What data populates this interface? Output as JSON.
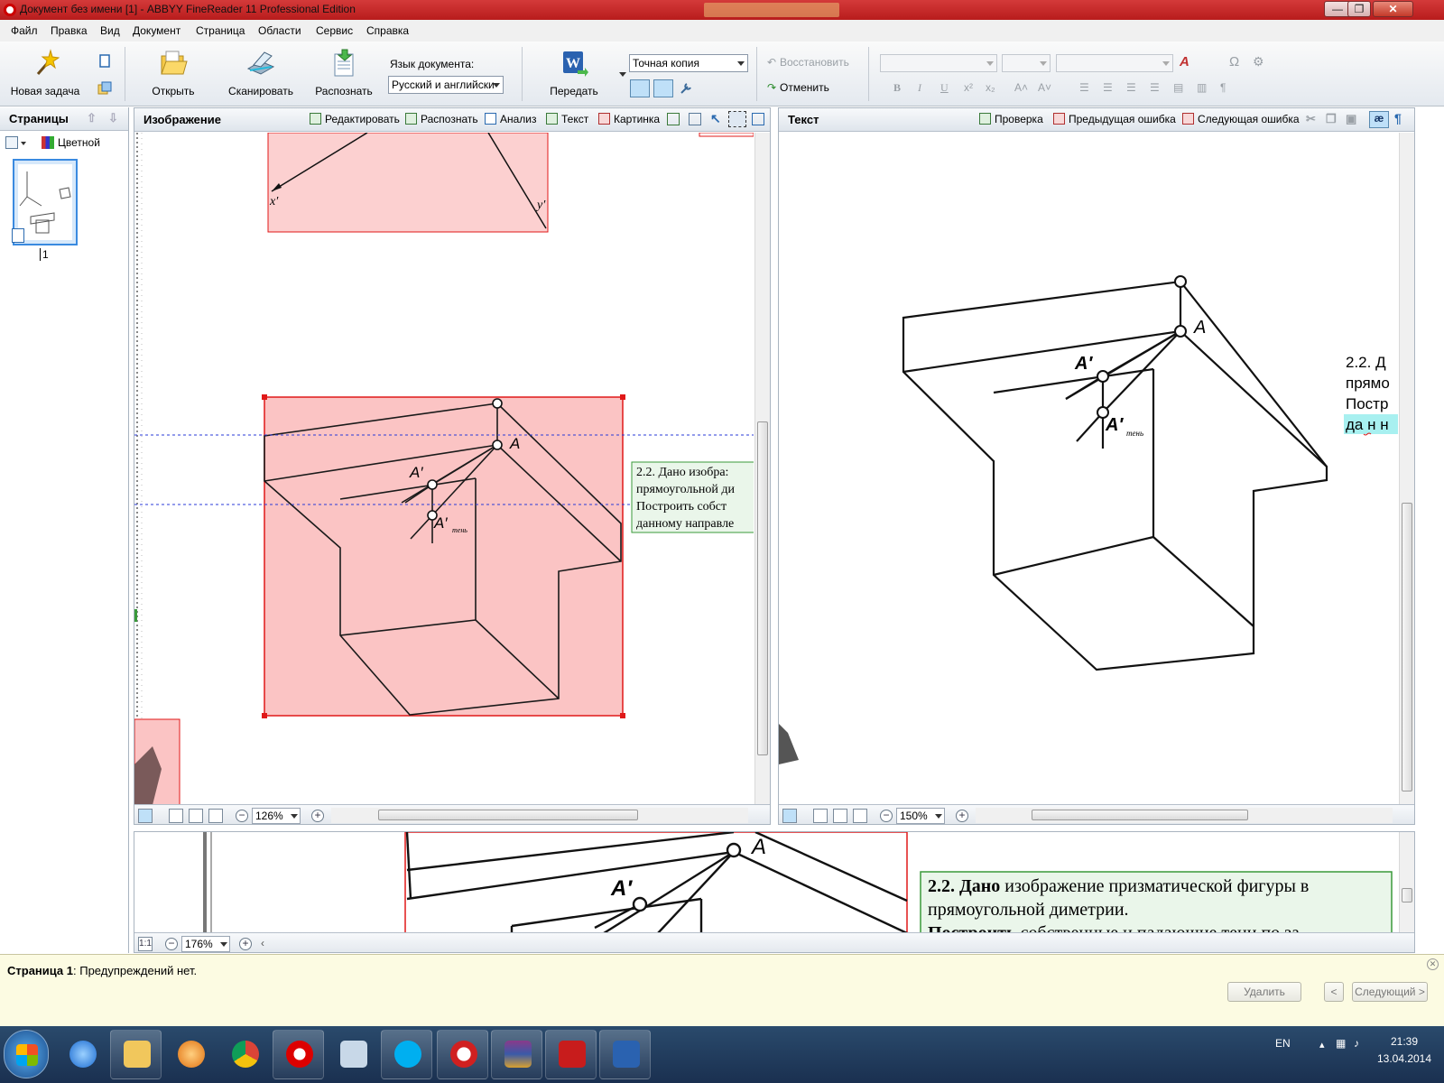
{
  "window": {
    "title": "Документ без имени [1] - ABBYY FineReader 11 Professional Edition",
    "minimize": "—",
    "maximize": "❐",
    "close": "✕"
  },
  "menu": [
    "Файл",
    "Правка",
    "Вид",
    "Документ",
    "Страница",
    "Области",
    "Сервис",
    "Справка"
  ],
  "toolbar": {
    "new_task": "Новая задача",
    "open": "Открыть",
    "scan": "Сканировать",
    "recognize": "Распознать",
    "doc_language_label": "Язык документа:",
    "doc_language_value": "Русский и английски",
    "send": "Передать",
    "format_value": "Точная копия",
    "undo": "Восстановить",
    "redo": "Отменить",
    "bold": "B",
    "italic": "I",
    "underline": "U",
    "omega": "Ω"
  },
  "pages_panel": {
    "title": "Страницы",
    "color_mode": "Цветной",
    "page_number": "1"
  },
  "image_pane": {
    "title": "Изображение",
    "buttons": [
      "Редактировать",
      "Распознать",
      "Анализ",
      "Текст",
      "Картинка"
    ],
    "zoom": "126%",
    "labels": {
      "x": "x′",
      "y": "y′",
      "a": "A",
      "a_prime": "A′",
      "a_shadow": "A′",
      "shadow_sub": "тень"
    },
    "text_block_lines": [
      "2.2. Дано изобра:",
      "прямоугольной ди",
      "Построить собст",
      "данному направле"
    ]
  },
  "text_pane": {
    "title": "Текст",
    "buttons": [
      "Проверка",
      "Предыдущая ошибка",
      "Следующая ошибка"
    ],
    "zoom": "150%",
    "labels": {
      "a": "A",
      "a_prime": "A′",
      "a_shadow": "A′",
      "shadow_sub": "тень"
    },
    "text_lines": [
      "2.2. Д",
      "прямо",
      "Постр",
      "да н н"
    ]
  },
  "zoom_pane": {
    "zoom": "176%",
    "fit_label": "1:1",
    "labels": {
      "a": "A",
      "a_prime": "A′"
    },
    "text_line_1_bold": "2.2. Дано",
    "text_line_1_rest": " изображение призматической фигуры в",
    "text_line_2": "прямоугольной диметрии.",
    "text_line_3_bold": "Построить",
    "text_line_3_rest": " собственные и падающие тени по за"
  },
  "warnings": {
    "page_label": "Страница 1",
    "message": ": Предупреждений нет.",
    "delete_button": "Удалить",
    "prev_button": "<",
    "next_button": "Следующий >"
  },
  "taskbar": {
    "language": "EN",
    "time": "21:39",
    "date": "13.04.2014"
  },
  "colors": {
    "title_bar": "#c32222",
    "picture_area": "#fbc4c4",
    "text_area": "#eaf6ea",
    "selection_border": "#e01818"
  }
}
